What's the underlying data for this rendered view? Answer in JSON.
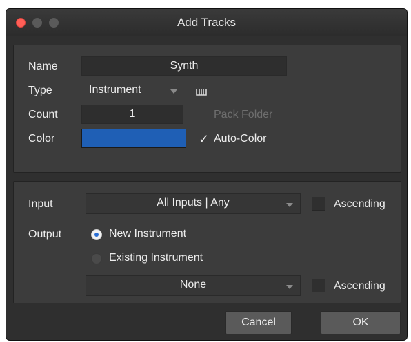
{
  "window": {
    "title": "Add Tracks"
  },
  "track": {
    "name_label": "Name",
    "name_value": "Synth",
    "type_label": "Type",
    "type_value": "Instrument",
    "count_label": "Count",
    "count_value": "1",
    "pack_folder_label": "Pack Folder",
    "color_label": "Color",
    "color_value": "#1f5fb5",
    "auto_color_label": "Auto-Color",
    "auto_color_checked": true
  },
  "routing": {
    "input_label": "Input",
    "input_value": "All Inputs | Any",
    "input_ascending_label": "Ascending",
    "output_label": "Output",
    "new_instrument_label": "New Instrument",
    "existing_instrument_label": "Existing Instrument",
    "existing_value": "None",
    "output_ascending_label": "Ascending"
  },
  "buttons": {
    "cancel": "Cancel",
    "ok": "OK"
  },
  "icons": {
    "checkmark": "✓",
    "keyboard": "piano-keyboard-icon"
  }
}
